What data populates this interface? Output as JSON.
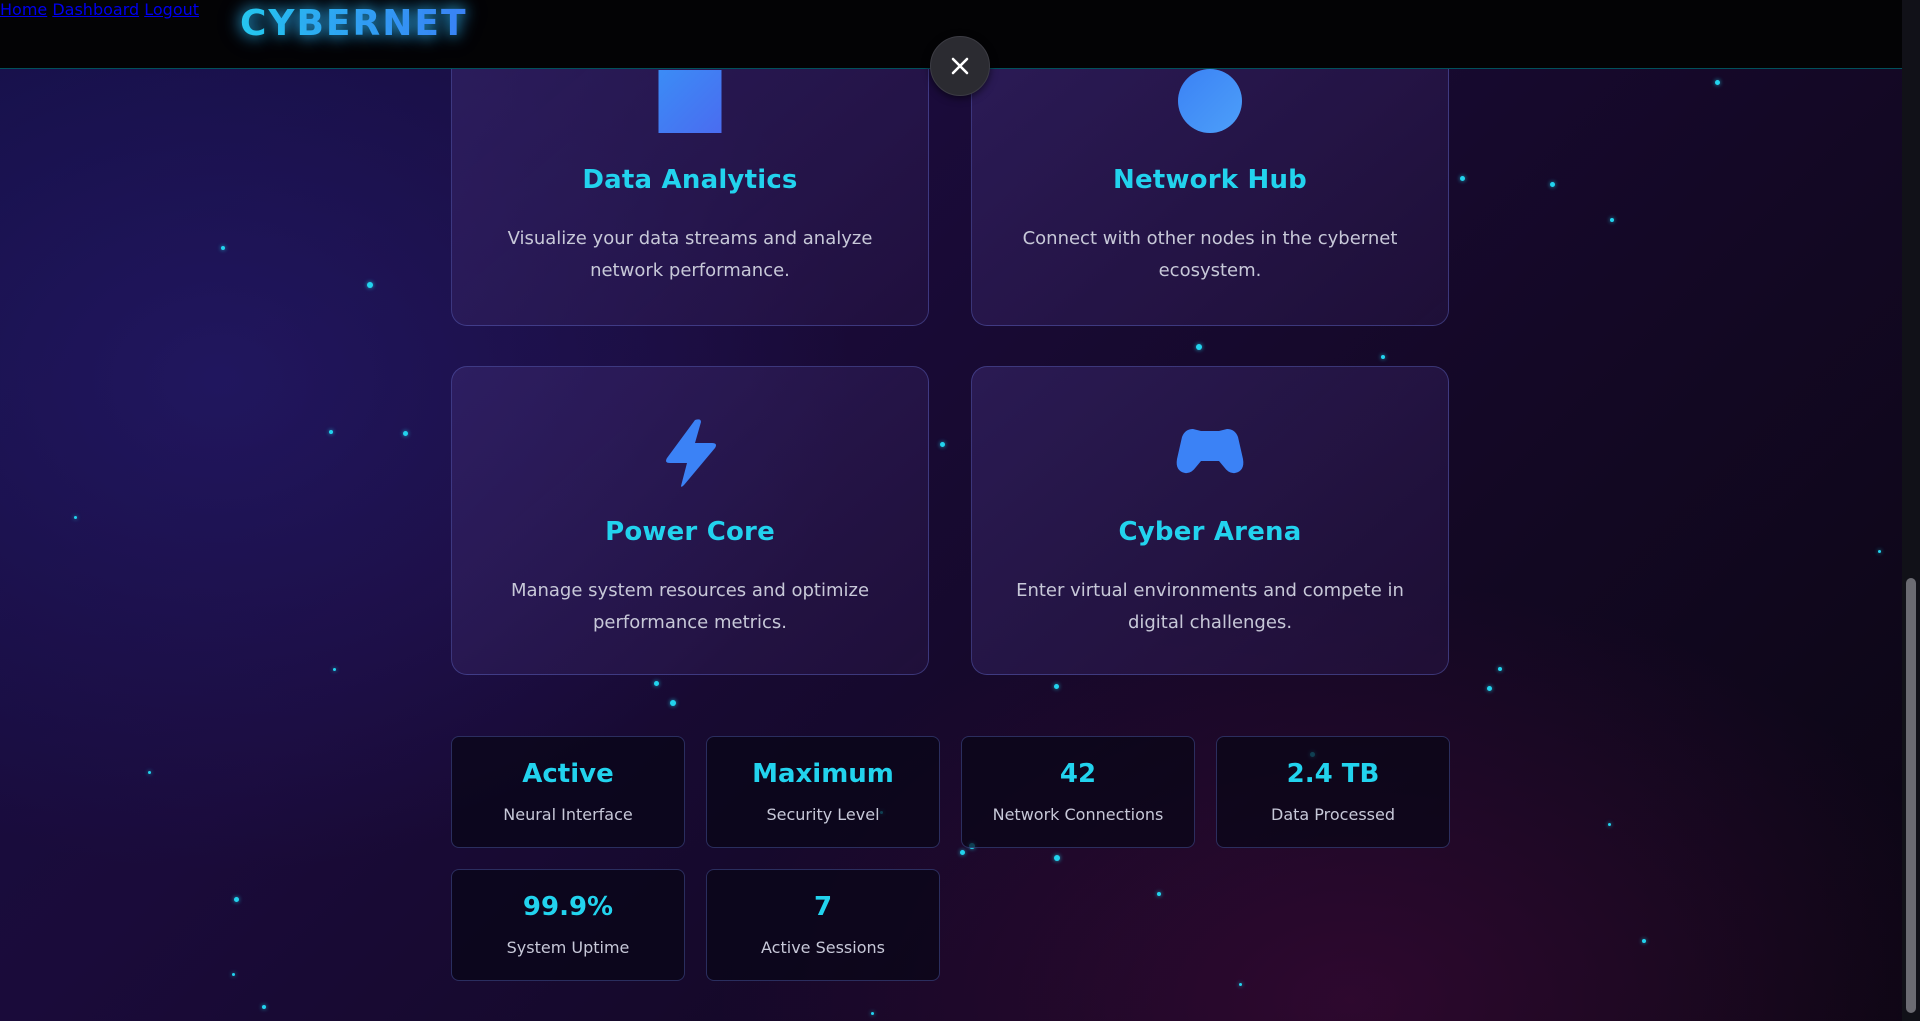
{
  "header": {
    "logo": "CYBERNET",
    "nav": [
      {
        "label": "Home"
      },
      {
        "label": "Dashboard"
      },
      {
        "label": "Logout"
      }
    ]
  },
  "overlay": {
    "close_icon": "close-icon"
  },
  "features": [
    {
      "icon": "square-icon",
      "title": "Data Analytics",
      "description": "Visualize your data streams and analyze network performance."
    },
    {
      "icon": "circle-icon",
      "title": "Network Hub",
      "description": "Connect with other nodes in the cybernet ecosystem."
    },
    {
      "icon": "lightning-icon",
      "title": "Power Core",
      "description": "Manage system resources and optimize performance metrics."
    },
    {
      "icon": "gamepad-icon",
      "title": "Cyber Arena",
      "description": "Enter virtual environments and compete in digital challenges."
    }
  ],
  "stats": [
    {
      "value": "Active",
      "label": "Neural Interface"
    },
    {
      "value": "Maximum",
      "label": "Security Level"
    },
    {
      "value": "42",
      "label": "Network Connections"
    },
    {
      "value": "2.4 TB",
      "label": "Data Processed"
    },
    {
      "value": "99.9%",
      "label": "System Uptime"
    },
    {
      "value": "7",
      "label": "Active Sessions"
    }
  ],
  "colors": {
    "accent": "#22d3ee",
    "icon_blue": "#3b82f6",
    "header_bg": "#030305"
  }
}
